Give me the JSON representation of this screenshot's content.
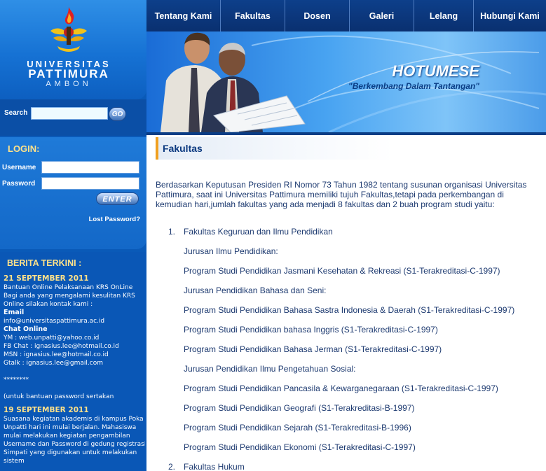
{
  "sidebar": {
    "logo": {
      "line1": "UNIVERSITAS",
      "line2": "PATTIMURA",
      "line3": "AMBON"
    },
    "search": {
      "label": "Search",
      "value": "",
      "button_label": "GO"
    },
    "login": {
      "title": "LOGIN:",
      "username_label": "Username",
      "password_label": "Password",
      "username_value": "",
      "password_value": "",
      "enter_label": "ENTER",
      "lost_password": "Lost Password?"
    },
    "berita": {
      "title": "BERITA TERKINI :",
      "news1": {
        "date": "21 SEPTEMBER 2011",
        "lines": [
          "Bantuan Online Pelaksanaan KRS OnLine",
          "Bagi anda yang mengalami kesulitan KRS",
          "Online silakan kontak kami :"
        ],
        "email_label": "Email",
        "email": "info@universitaspattimura.ac.id",
        "chat_label": "Chat Online",
        "chat_lines": [
          "YM : web.unpatti@yahoo.co.id",
          "FB Chat  : ignasius.lee@hotmail.co.id",
          "MSN : ignasius.lee@hotmail.co.id",
          "Gtalk : ignasius.lee@gmail.com"
        ],
        "stars": "********",
        "note": "(untuk bantuan password sertakan"
      },
      "news2": {
        "date": "19 SEPTEMBER 2011",
        "lines": [
          "Suasana kegiatan akademis di kampus Poka",
          "Unpatti hari ini mulai berjalan. Mahasiswa",
          "mulai melakukan kegiatan pengambilan",
          "Username dan Password di gedung registrasi",
          "Simpati yang digunakan untuk melakukan",
          "sistem"
        ]
      }
    }
  },
  "nav": {
    "items": [
      "Tentang Kami",
      "Fakultas",
      "Dosen",
      "Galeri",
      "Lelang",
      "Hubungi Kami"
    ]
  },
  "banner": {
    "title": "HOTUMESE",
    "tagline": "\"Berkembang Dalam Tantangan\""
  },
  "content": {
    "heading": "Fakultas",
    "intro": "Berdasarkan Keputusan Presiden RI Nomor 73 Tahun 1982 tentang susunan organisasi Universitas Pattimura, saat ini Universitas Pattimura memiliki tujuh Fakultas,tetapi pada perkembangan di kemudian hari,jumlah fakultas yang ada menjadi 8 fakultas dan 2 buah program studi yaitu:",
    "faculty1": {
      "number": "1.",
      "name": "Fakultas Keguruan dan Ilmu Pendidikan",
      "entries": [
        "Jurusan Ilmu Pendidikan:",
        "Program Studi Pendidikan Jasmani Kesehatan & Rekreasi (S1-Terakreditasi-C-1997)",
        "Jurusan Pendidikan Bahasa dan Seni:",
        "Program Studi Pendidikan Bahasa Sastra Indonesia & Daerah (S1-Terakreditasi-C-1997)",
        "Program Studi Pendidikan bahasa Inggris (S1-Terakreditasi-C-1997)",
        "Program Studi Pendidikan Bahasa Jerman (S1-Terakreditasi-C-1997)",
        "Jurusan Pendidikan Ilmu Pengetahuan Sosial:",
        "Program Studi Pendidikan Pancasila & Kewarganegaraan (S1-Terakreditasi-C-1997)",
        "Program Studi Pendidikan Geografi (S1-Terakreditasi-B-1997)",
        "Program Studi Pendidikan Sejarah (S1-Terakreditasi-B-1996)",
        "Program Studi Pendidikan Ekonomi (S1-Terakreditasi-C-1997)"
      ]
    },
    "faculty2": {
      "number": "2.",
      "name": "Fakultas Hukum"
    }
  }
}
